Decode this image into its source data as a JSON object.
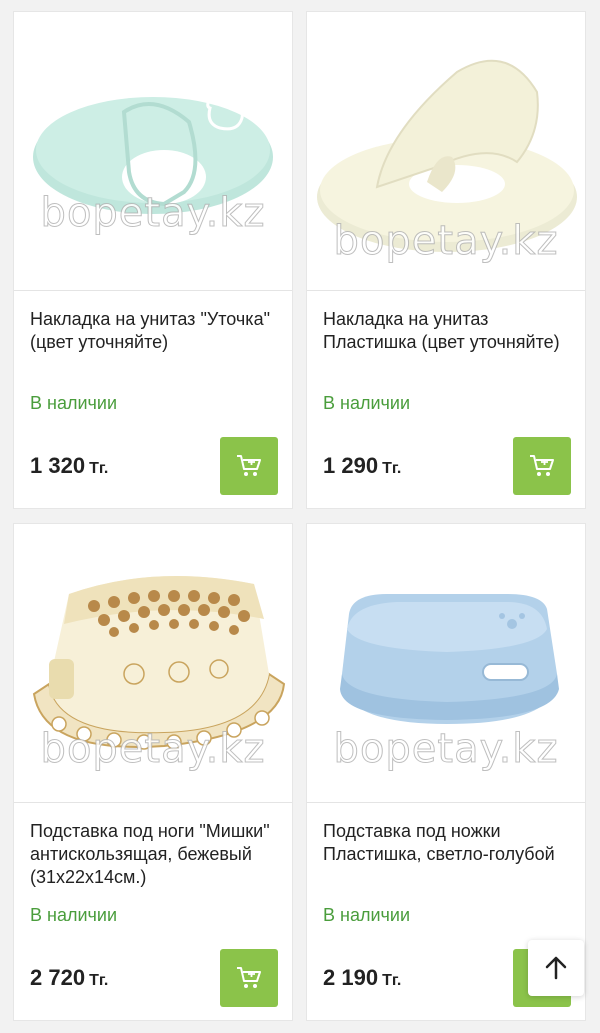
{
  "watermark": "bopetay.kz",
  "colors": {
    "accent": "#8bc34a",
    "in_stock": "#4a9d3c"
  },
  "products": [
    {
      "title": "Накладка на унитаз \"Уточка\" (цвет уточняйте)",
      "availability": "В наличии",
      "price": "1 320",
      "currency": "Тг.",
      "image": "toilet-seat-duck-mint"
    },
    {
      "title": "Накладка на унитаз Пластишка (цвет уточняйте)",
      "availability": "В наличии",
      "price": "1 290",
      "currency": "Тг.",
      "image": "toilet-seat-cream"
    },
    {
      "title": "Подставка под ноги \"Мишки\" антискользящая, бежевый (31х22х14см.)",
      "availability": "В наличии",
      "price": "2 720",
      "currency": "Тг.",
      "image": "step-stool-bears"
    },
    {
      "title": "Подставка под ножки Пластишка, светло-голубой",
      "availability": "В наличии",
      "price": "2 190",
      "currency": "Тг.",
      "image": "step-stool-light-blue"
    }
  ],
  "icons": {
    "cart": "cart-icon",
    "scroll_top": "arrow-up-icon"
  }
}
